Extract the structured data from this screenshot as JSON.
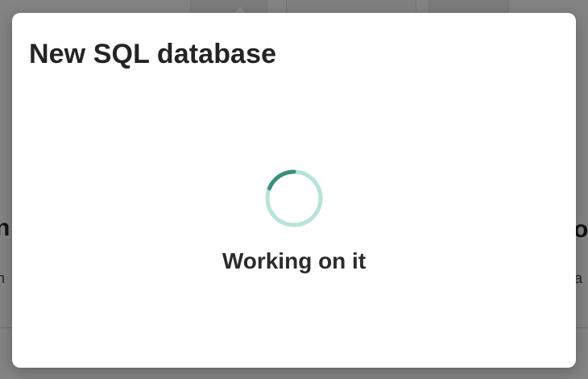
{
  "dialog": {
    "title": "New SQL database",
    "status": "Working on it"
  },
  "background": {
    "fragment_left_heading": "n",
    "fragment_right_heading": "o",
    "fragment_left_text": "n",
    "fragment_right_text": "ta"
  },
  "colors": {
    "spinner_track": "#b7e3d8",
    "spinner_arc": "#3a8f7c",
    "dialog_background": "#ffffff",
    "overlay": "#000000"
  },
  "icons": {
    "spinner": "loading-spinner-icon"
  }
}
